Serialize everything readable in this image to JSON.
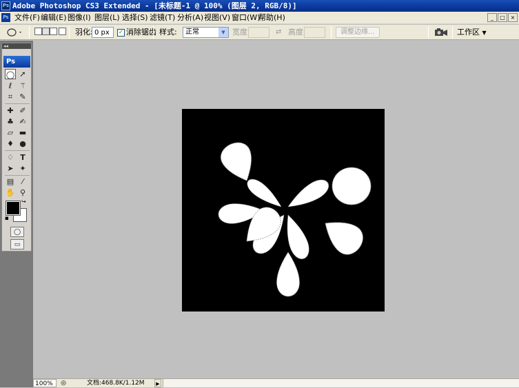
{
  "titlebar": {
    "title": "Adobe Photoshop CS3 Extended - [未标题-1 @ 100% (图层 2, RGB/8)]",
    "icon_text": "Ps"
  },
  "menu": {
    "icon_text": "Ps",
    "items": [
      "文件(F)",
      "编辑(E)",
      "图像(I)",
      "图层(L)",
      "选择(S)",
      "滤镜(T)",
      "分析(A)",
      "视图(V)",
      "窗口(W)",
      "帮助(H)"
    ],
    "window_buttons": [
      "_",
      "□",
      "×"
    ]
  },
  "options": {
    "feather_label": "羽化:",
    "feather_value": "0 px",
    "antialias_label": "消除锯齿",
    "antialias_checked": true,
    "style_label": "样式:",
    "style_value": "正常",
    "width_label": "宽度:",
    "height_label": "高度:",
    "refine_edge_label": "调整边缘...",
    "workspace_label": "工作区"
  },
  "toolbox": {
    "logo": "Ps",
    "collapse": "◂◂"
  },
  "statusbar": {
    "zoom": "100%",
    "doc_info": "文档:468.8K/1.12M"
  },
  "colors": {
    "foreground": "#000000",
    "background": "#ffffff",
    "canvas": "#000000",
    "workspace": "#c0c0c0"
  }
}
